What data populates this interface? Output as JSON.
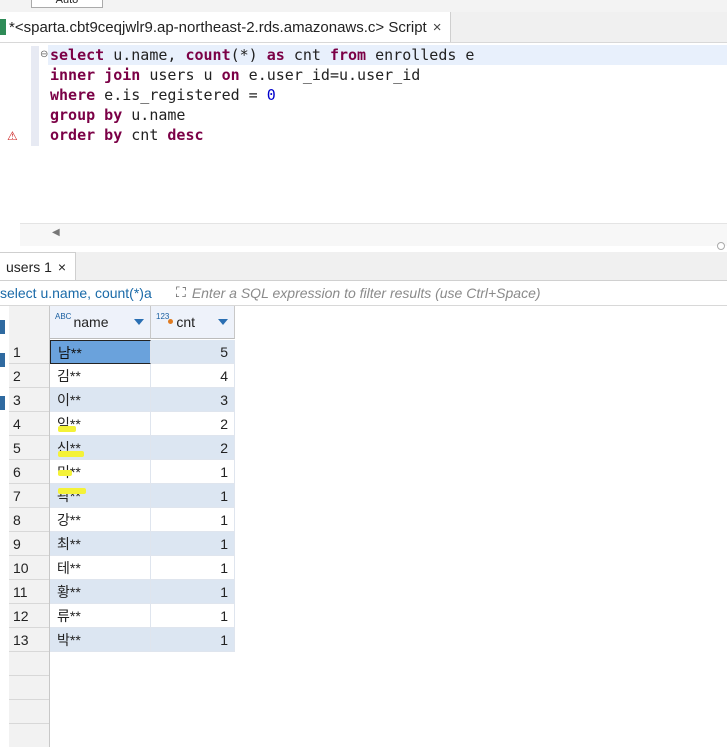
{
  "toolbar": {
    "auto_label": "Auto"
  },
  "editor_tab": {
    "title": "*<sparta.cbt9ceqjwlr9.ap-northeast-2.rds.amazonaws.c> Script",
    "close": "×"
  },
  "sql": {
    "line1": {
      "k1": "select",
      "t1": " u.name, ",
      "k2": "count",
      "t2": "(*) ",
      "k3": "as",
      "t3": " cnt ",
      "k4": "from",
      "t4": " enrolleds e"
    },
    "line2": {
      "k1": "inner join",
      "t1": " users u ",
      "k2": "on",
      "t2": " e.user_id=u.user_id"
    },
    "line3": {
      "k1": "where",
      "t1": " e.is_registered = ",
      "n1": "0"
    },
    "line4": {
      "k1": "group by",
      "t1": " u.name"
    },
    "line5": {
      "k1": "order by",
      "t1": " cnt ",
      "k2": "desc"
    }
  },
  "results_tab": {
    "label": "users 1",
    "close": "×"
  },
  "filter": {
    "query_text": "select u.name, count(*)a",
    "placeholder": "Enter a SQL expression to filter results (use Ctrl+Space)"
  },
  "grid": {
    "columns": [
      {
        "type_badge": "ABC",
        "label": "name"
      },
      {
        "type_badge": "123",
        "label": "cnt"
      }
    ],
    "rows": [
      {
        "n": "1",
        "name": "남**",
        "cnt": "5"
      },
      {
        "n": "2",
        "name": "김**",
        "cnt": "4"
      },
      {
        "n": "3",
        "name": "이**",
        "cnt": "3"
      },
      {
        "n": "4",
        "name": "임**",
        "cnt": "2"
      },
      {
        "n": "5",
        "name": "신**",
        "cnt": "2"
      },
      {
        "n": "6",
        "name": "미**",
        "cnt": "1"
      },
      {
        "n": "7",
        "name": "곽**",
        "cnt": "1"
      },
      {
        "n": "8",
        "name": "강**",
        "cnt": "1"
      },
      {
        "n": "9",
        "name": "최**",
        "cnt": "1"
      },
      {
        "n": "10",
        "name": "테**",
        "cnt": "1"
      },
      {
        "n": "11",
        "name": "황**",
        "cnt": "1"
      },
      {
        "n": "12",
        "name": "류**",
        "cnt": "1"
      },
      {
        "n": "13",
        "name": "박**",
        "cnt": "1"
      }
    ]
  },
  "colors": {
    "keyword": "#7b0046",
    "number": "#0000cc",
    "stripe": "#dce6f2",
    "selection": "#6aa2dc",
    "highlight": "#f4f238"
  }
}
